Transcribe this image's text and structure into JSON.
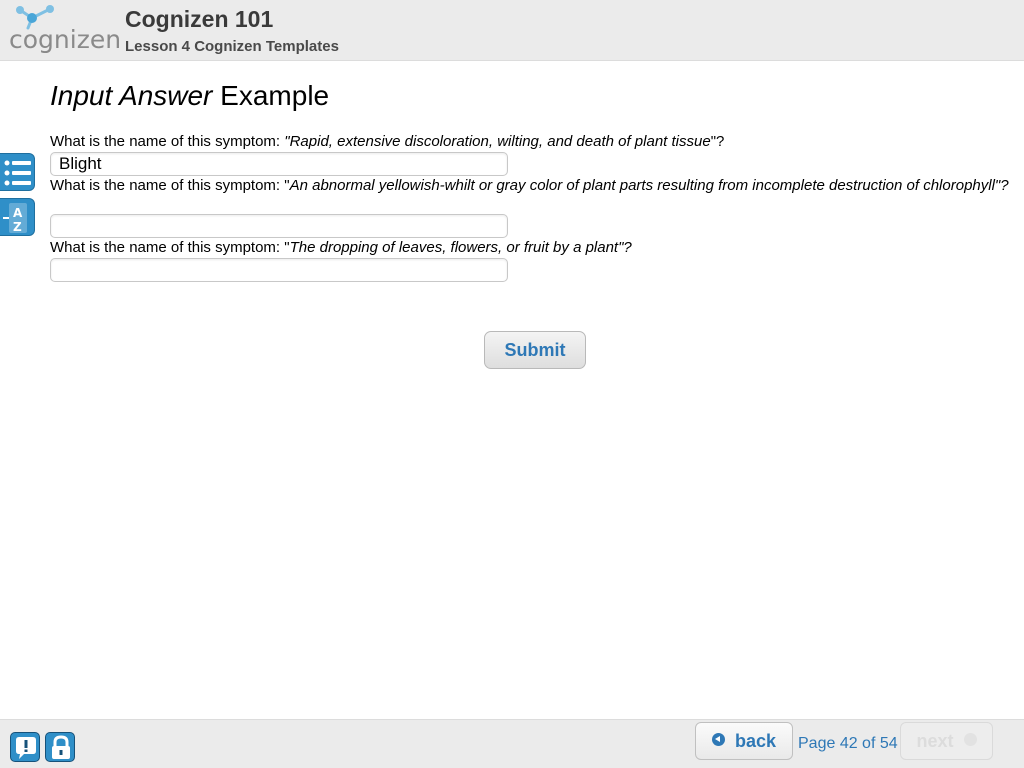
{
  "header": {
    "logo_text": "cognizen",
    "course_title": "Cognizen 101",
    "lesson_title": "Lesson 4 Cognizen Templates"
  },
  "sidebar": {
    "menu_icon": "list-menu-icon",
    "glossary_icon": "a-z-glossary-icon"
  },
  "main": {
    "heading_italic": "Input Answer",
    "heading_rest": " Example",
    "questions": [
      {
        "prefix": "What is the name of this symptom: ",
        "open_quote": "\"",
        "text": "Rapid, extensive discoloration, wilting, and death of plant tissue",
        "close": "\"?",
        "answer": "Blight"
      },
      {
        "prefix": "What is the name of this symptom: ",
        "open_quote": "\"",
        "text": "An abnormal yellowish-whilt or gray color of plant parts resulting from incomplete destruction of chlorophyll\"?",
        "close": "",
        "answer": ""
      },
      {
        "prefix": "What is the name of this symptom: ",
        "open_quote": "\"",
        "text": "The dropping of leaves, flowers, or fruit by a plant\"?",
        "close": "",
        "answer": ""
      }
    ],
    "submit_label": "Submit"
  },
  "footer": {
    "help_icon": "help-exclamation-icon",
    "lock_icon": "lock-icon",
    "back_label": "back",
    "page_counter": "Page 42 of 54",
    "next_label": "next"
  },
  "colors": {
    "accent_blue": "#2e78b6",
    "icon_blue": "#2f8fc8",
    "header_bg": "#ebebeb"
  }
}
